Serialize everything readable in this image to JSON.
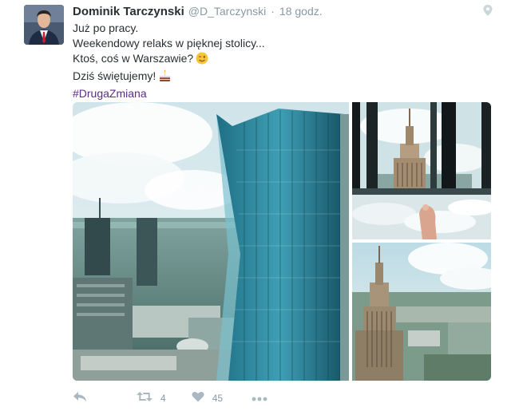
{
  "tweet": {
    "author_name": "Dominik Tarczynski",
    "handle": "@D_Tarczynski",
    "separator": "·",
    "timestamp": "18 godz.",
    "lines": [
      "Już po pracy.",
      "Weekendowy relaks w pięknej stolicy...",
      "Ktoś, coś w Warszawie?",
      "Dziś świętujemy!"
    ],
    "hashtag": "#DrugaZmiana",
    "emojis": [
      "winking-face",
      "birthday-cake"
    ],
    "photos": [
      "warsaw-skyscraper-photo",
      "palace-of-culture-window-bath-photo",
      "palace-of-culture-aerial-photo"
    ]
  },
  "actions": {
    "reply_icon": "reply-icon",
    "retweet_icon": "retweet-icon",
    "retweet_count": "4",
    "like_icon": "heart-icon",
    "like_count": "45",
    "more_icon": "more-icon"
  },
  "colors": {
    "text": "#292f33",
    "muted": "#8899a6",
    "icon": "#aab8c2",
    "hashtag": "#5b2a86"
  }
}
